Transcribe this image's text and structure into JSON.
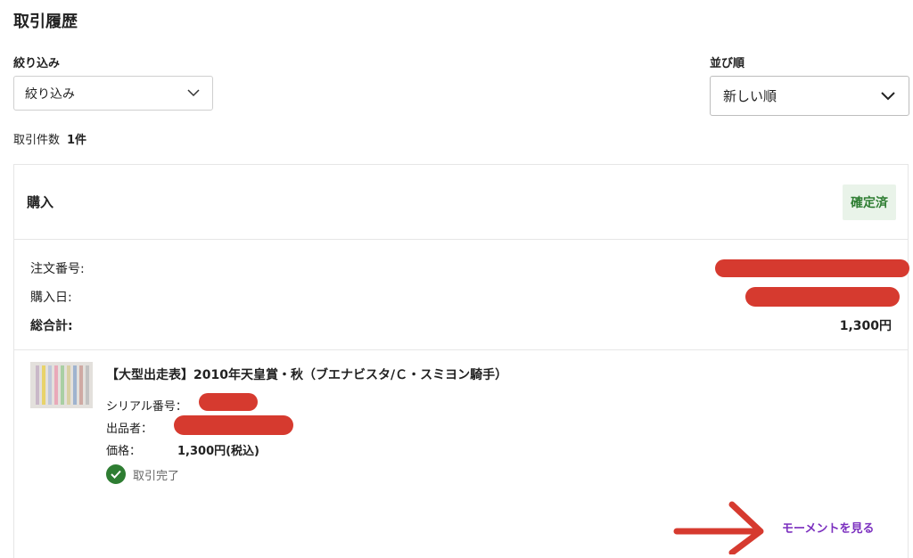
{
  "page": {
    "title": "取引履歴"
  },
  "filter": {
    "label": "絞り込み",
    "selected": "絞り込み"
  },
  "sort": {
    "label": "並び順",
    "selected": "新しい順"
  },
  "count": {
    "label": "取引件数",
    "value": "1件"
  },
  "transaction": {
    "type": "購入",
    "status_badge": "確定済",
    "order_number_label": "注文番号:",
    "purchase_date_label": "購入日:",
    "total_label": "総合計:",
    "total_value": "1,300円",
    "item": {
      "title": "【大型出走表】2010年天皇賞・秋（ブエナビスタ/Ｃ・スミヨン騎手）",
      "serial_label": "シリアル番号：",
      "seller_label": "出品者：",
      "price_label": "価格：",
      "price_value": "1,300円(税込)",
      "trade_status": "取引完了",
      "moment_link": "モーメントを見る"
    }
  },
  "colors": {
    "accent_purple": "#7b2fbf",
    "status_green": "#2e7d32",
    "redaction_red": "#d63a2f"
  },
  "icons": [
    "chevron-down-icon",
    "check-circle-icon",
    "arrow-right-annotation"
  ]
}
